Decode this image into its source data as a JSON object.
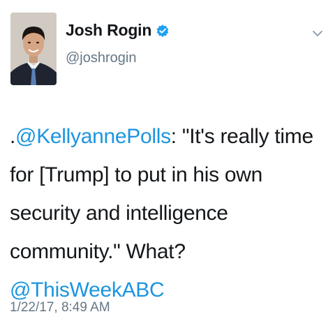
{
  "author": {
    "display_name": "Josh Rogin",
    "handle": "@joshrogin",
    "verified_icon": "verified-badge-icon"
  },
  "tweet": {
    "prefix": ".",
    "mention_1": "@KellyannePolls",
    "body": ": \"It's really time for [Trump] to put in his own security and intelligence community.\" What?",
    "mention_2": "@ThisWeekABC"
  },
  "timestamp": "1/22/17, 8:49 AM",
  "menu_icon": "chevron-down-icon",
  "colors": {
    "link": "#1b95e0",
    "secondary": "#657786",
    "text": "#14171a",
    "verified": "#1da1f2"
  }
}
